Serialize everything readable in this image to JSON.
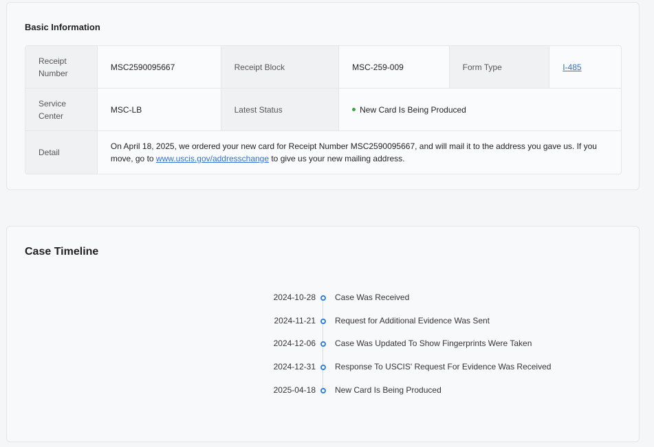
{
  "basic_info": {
    "title": "Basic Information",
    "receipt_number_label": "Receipt Number",
    "receipt_number_value": "MSC2590095667",
    "receipt_block_label": "Receipt Block",
    "receipt_block_value": "MSC-259-009",
    "form_type_label": "Form Type",
    "form_type_value": "I-485",
    "service_center_label": "Service Center",
    "service_center_value": "MSC-LB",
    "latest_status_label": "Latest Status",
    "latest_status_value": "New Card Is Being Produced",
    "latest_status_color": "#3aa53a",
    "detail_label": "Detail",
    "detail_text_before": "On April 18, 2025, we ordered your new card for Receipt Number MSC2590095667, and will mail it to the address you gave us. If you move, go to ",
    "detail_link": "www.uscis.gov/addresschange",
    "detail_text_after": " to give us your new mailing address."
  },
  "timeline": {
    "title": "Case Timeline",
    "accent_color": "#2f7fe0",
    "events": [
      {
        "date": "2024-10-28",
        "label": "Case Was Received"
      },
      {
        "date": "2024-11-21",
        "label": "Request for Additional Evidence Was Sent"
      },
      {
        "date": "2024-12-06",
        "label": "Case Was Updated To Show Fingerprints Were Taken"
      },
      {
        "date": "2024-12-31",
        "label": "Response To USCIS' Request For Evidence Was Received"
      },
      {
        "date": "2025-04-18",
        "label": "New Card Is Being Produced"
      }
    ]
  }
}
